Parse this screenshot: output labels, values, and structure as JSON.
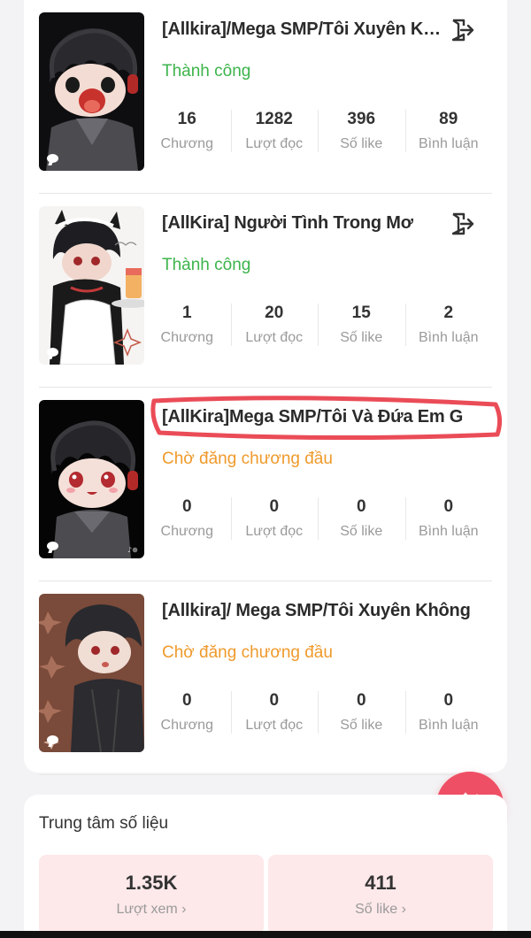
{
  "works": [
    {
      "title": "[Allkira]/Mega SMP/Tôi Xuyên Không Đến Thế Giới Mega",
      "status": "Thành công",
      "status_type": "ok",
      "has_exit_icon": true,
      "cover": "boy-dark-hair-red-eyes-open-mouth-headphones",
      "stats": [
        {
          "value": "16",
          "label": "Chương"
        },
        {
          "value": "1282",
          "label": "Lượt đọc"
        },
        {
          "value": "396",
          "label": "Số like"
        },
        {
          "value": "89",
          "label": "Bình luận"
        }
      ]
    },
    {
      "title": "[AllKira] Người Tình Trong Mơ",
      "status": "Thành công",
      "status_type": "ok",
      "has_exit_icon": true,
      "cover": "maid-boy-with-drink",
      "stats": [
        {
          "value": "1",
          "label": "Chương"
        },
        {
          "value": "20",
          "label": "Lượt đọc"
        },
        {
          "value": "15",
          "label": "Số like"
        },
        {
          "value": "2",
          "label": "Bình luận"
        }
      ]
    },
    {
      "title": "[AllKira]Mega SMP/Tôi Và Đứa Em G",
      "status": "Chờ đăng chương đầu",
      "status_type": "wait",
      "has_exit_icon": false,
      "highlighted": true,
      "cover": "chibi-boy-headphones-blush",
      "stats": [
        {
          "value": "0",
          "label": "Chương"
        },
        {
          "value": "0",
          "label": "Lượt đọc"
        },
        {
          "value": "0",
          "label": "Số like"
        },
        {
          "value": "0",
          "label": "Bình luận"
        }
      ]
    },
    {
      "title": "[Allkira]/ Mega SMP/Tôi Xuyên Không",
      "status": "Chờ đăng chương đầu",
      "status_type": "wait",
      "has_exit_icon": false,
      "cover": "boy-black-hoodie-pattern-background",
      "stats": [
        {
          "value": "0",
          "label": "Chương"
        },
        {
          "value": "0",
          "label": "Lượt đọc"
        },
        {
          "value": "0",
          "label": "Số like"
        },
        {
          "value": "0",
          "label": "Bình luận"
        }
      ]
    }
  ],
  "fab": {
    "icon": "pencil-sparkle-icon",
    "color": "#ef4f64"
  },
  "data_center": {
    "title": "Trung tâm số liệu",
    "metrics": [
      {
        "value": "1.35K",
        "label": "Lượt xem ›"
      },
      {
        "value": "411",
        "label": "Số like ›"
      }
    ]
  },
  "colors": {
    "success": "#3cb44b",
    "pending": "#ef9a2b",
    "accent": "#ef4f64",
    "metric_bg": "#fde8ea"
  }
}
